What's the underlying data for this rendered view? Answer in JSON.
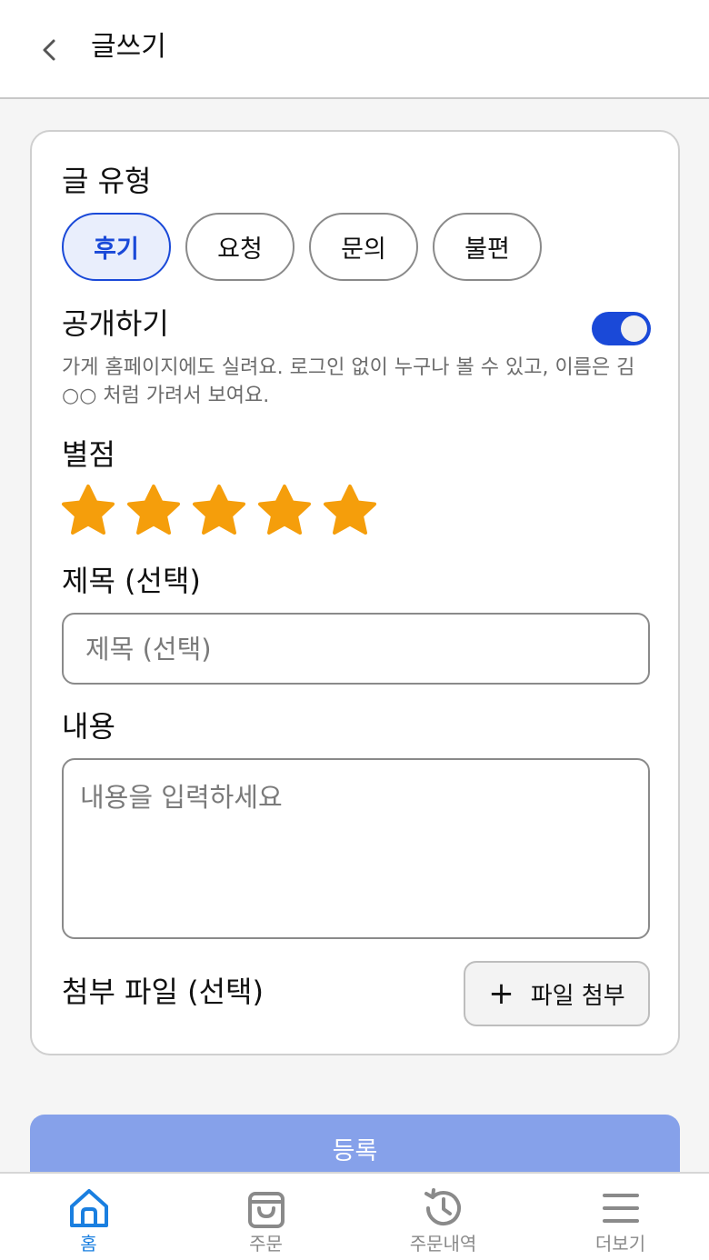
{
  "header": {
    "title": "글쓰기"
  },
  "form": {
    "post_type_label": "글 유형",
    "post_types": [
      {
        "label": "후기",
        "selected": true
      },
      {
        "label": "요청",
        "selected": false
      },
      {
        "label": "문의",
        "selected": false
      },
      {
        "label": "불편",
        "selected": false
      }
    ],
    "public_label": "공개하기",
    "public_enabled": true,
    "public_help": "가게 홈페이지에도 실려요. 로그인 없이 누구나 볼 수 있고, 이름은 김○○ 처럼 가려서 보여요.",
    "rating_label": "별점",
    "rating": 5,
    "rating_max": 5,
    "title_label": "제목 (선택)",
    "title_placeholder": "제목 (선택)",
    "content_label": "내용",
    "content_placeholder": "내용을 입력하세요",
    "attachment_label": "첨부 파일 (선택)",
    "attach_button_label": "파일 첨부",
    "submit_label": "등록"
  },
  "colors": {
    "accent": "#1a49d8",
    "star": "#f59e0b",
    "submit_disabled": "#86a1ea",
    "nav_active": "#1a7fe0"
  },
  "bottom_nav": [
    {
      "label": "홈",
      "icon": "home-icon",
      "active": true
    },
    {
      "label": "주문",
      "icon": "shopping-bag-icon",
      "active": false
    },
    {
      "label": "주문내역",
      "icon": "history-icon",
      "active": false
    },
    {
      "label": "더보기",
      "icon": "menu-icon",
      "active": false
    }
  ]
}
